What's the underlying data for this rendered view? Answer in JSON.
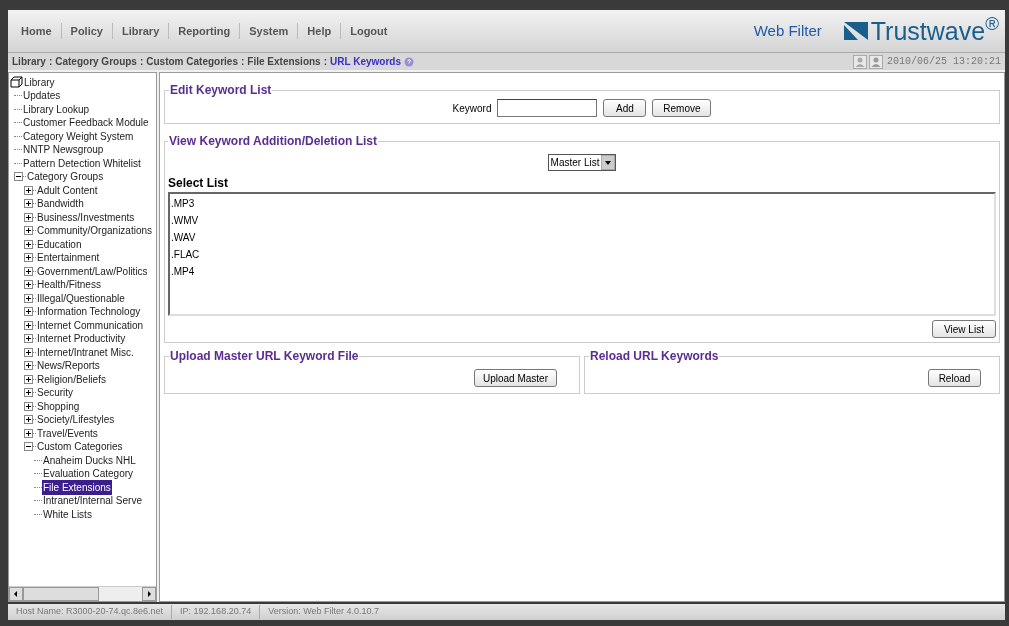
{
  "nav": [
    {
      "label": "Home"
    },
    {
      "label": "Policy"
    },
    {
      "label": "Library"
    },
    {
      "label": "Reporting"
    },
    {
      "label": "System"
    },
    {
      "label": "Help"
    },
    {
      "label": "Logout"
    }
  ],
  "product": "Web Filter",
  "logo": "Trustwave$^{®}$",
  "breadcrumb_separator": ":",
  "breadcrumb": [
    {
      "label": "Library",
      "current": false
    },
    {
      "label": "Category Groups",
      "current": false
    },
    {
      "label": "Custom Categories",
      "current": false
    },
    {
      "label": "File Extensions",
      "current": false
    },
    {
      "label": "URL Keywords",
      "current": true
    }
  ],
  "timestamp": "2010/06/25 13:20:21",
  "tree": {
    "label": "Library",
    "children": [
      {
        "label": "Updates",
        "kind": "leaf",
        "selected": false
      },
      {
        "label": "Library Lookup",
        "kind": "leaf",
        "selected": false
      },
      {
        "label": "Customer Feedback Module",
        "kind": "leaf",
        "selected": false
      },
      {
        "label": "Category Weight System",
        "kind": "leaf",
        "selected": false
      },
      {
        "label": "NNTP Newsgroup",
        "kind": "leaf",
        "selected": false
      },
      {
        "label": "Pattern Detection Whitelist",
        "kind": "leaf",
        "selected": false
      },
      {
        "label": "Category Groups",
        "kind": "group",
        "expanded": true,
        "selected": false,
        "children": [
          {
            "label": "Adult Content",
            "kind": "group",
            "expanded": false,
            "selected": false
          },
          {
            "label": "Bandwidth",
            "kind": "group",
            "expanded": false,
            "selected": false
          },
          {
            "label": "Business/Investments",
            "kind": "group",
            "expanded": false,
            "selected": false
          },
          {
            "label": "Community/Organizations",
            "kind": "group",
            "expanded": false,
            "selected": false
          },
          {
            "label": "Education",
            "kind": "group",
            "expanded": false,
            "selected": false
          },
          {
            "label": "Entertainment",
            "kind": "group",
            "expanded": false,
            "selected": false
          },
          {
            "label": "Government/Law/Politics",
            "kind": "group",
            "expanded": false,
            "selected": false
          },
          {
            "label": "Health/Fitness",
            "kind": "group",
            "expanded": false,
            "selected": false
          },
          {
            "label": "Illegal/Questionable",
            "kind": "group",
            "expanded": false,
            "selected": false
          },
          {
            "label": "Information Technology",
            "kind": "group",
            "expanded": false,
            "selected": false
          },
          {
            "label": "Internet Communication",
            "kind": "group",
            "expanded": false,
            "selected": false
          },
          {
            "label": "Internet Productivity",
            "kind": "group",
            "expanded": false,
            "selected": false
          },
          {
            "label": "Internet/Intranet Misc.",
            "kind": "group",
            "expanded": false,
            "selected": false
          },
          {
            "label": "News/Reports",
            "kind": "group",
            "expanded": false,
            "selected": false
          },
          {
            "label": "Religion/Beliefs",
            "kind": "group",
            "expanded": false,
            "selected": false
          },
          {
            "label": "Security",
            "kind": "group",
            "expanded": false,
            "selected": false
          },
          {
            "label": "Shopping",
            "kind": "group",
            "expanded": false,
            "selected": false
          },
          {
            "label": "Society/Lifestyles",
            "kind": "group",
            "expanded": false,
            "selected": false
          },
          {
            "label": "Travel/Events",
            "kind": "group",
            "expanded": false,
            "selected": false
          },
          {
            "label": "Custom Categories",
            "kind": "group",
            "expanded": true,
            "selected": false,
            "children": [
              {
                "label": "Anaheim Ducks NHL",
                "kind": "leaf",
                "selected": false
              },
              {
                "label": "Evaluation Category",
                "kind": "leaf",
                "selected": false
              },
              {
                "label": "File Extensions",
                "kind": "leaf",
                "selected": true
              },
              {
                "label": "Intranet/Internal Serve",
                "kind": "leaf",
                "selected": false
              },
              {
                "label": "White Lists",
                "kind": "leaf",
                "selected": false
              }
            ]
          }
        ]
      }
    ]
  },
  "edit_keyword_list": {
    "title": "Edit Keyword List",
    "field_label": "Keyword",
    "buttons": [
      "Add",
      "Remove"
    ]
  },
  "view_list": {
    "title": "View Keyword Addition/Deletion List",
    "dropdown": "Master List",
    "list_label": "Select List",
    "items": [
      ".MP3",
      ".WMV",
      ".WAV",
      ".FLAC",
      ".MP4"
    ],
    "button": "View List"
  },
  "upload": {
    "title": "Upload Master URL Keyword File",
    "button": "Upload Master"
  },
  "reload": {
    "title": "Reload URL Keywords",
    "button": "Reload"
  },
  "status_bar": [
    "Host Name: R3000-20-74.qc.8e6.net",
    "IP: 192.168.20.74",
    "Version: Web Filter 4.0.10.7"
  ]
}
